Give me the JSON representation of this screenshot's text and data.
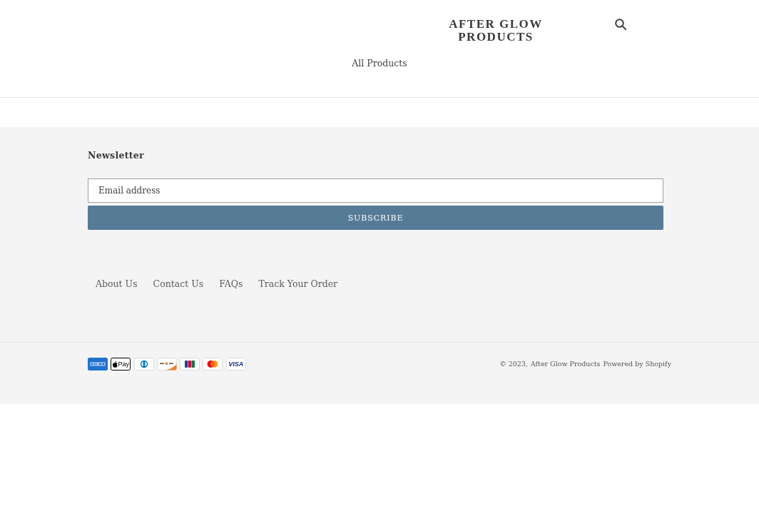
{
  "header": {
    "logo": "AFTER GLOW PRODUCTS",
    "nav": [
      "All Products"
    ]
  },
  "newsletter": {
    "title": "Newsletter",
    "email_field": {
      "placeholder": "Email address"
    },
    "button": "SUBSCRIBE"
  },
  "footer_links": [
    "About Us",
    "Contact Us",
    "FAQs",
    "Track Your Order"
  ],
  "payment_icons": [
    {
      "kind": "amex"
    },
    {
      "kind": "applepay",
      "label": "Pay"
    },
    {
      "kind": "diners"
    },
    {
      "kind": "discover"
    },
    {
      "kind": "jcb"
    },
    {
      "kind": "mastercard"
    },
    {
      "kind": "visa",
      "label": "VISA"
    }
  ],
  "copyright": {
    "notice": "© 2023,",
    "store_link": "After Glow Products",
    "powered_by": "Powered by Shopify"
  }
}
